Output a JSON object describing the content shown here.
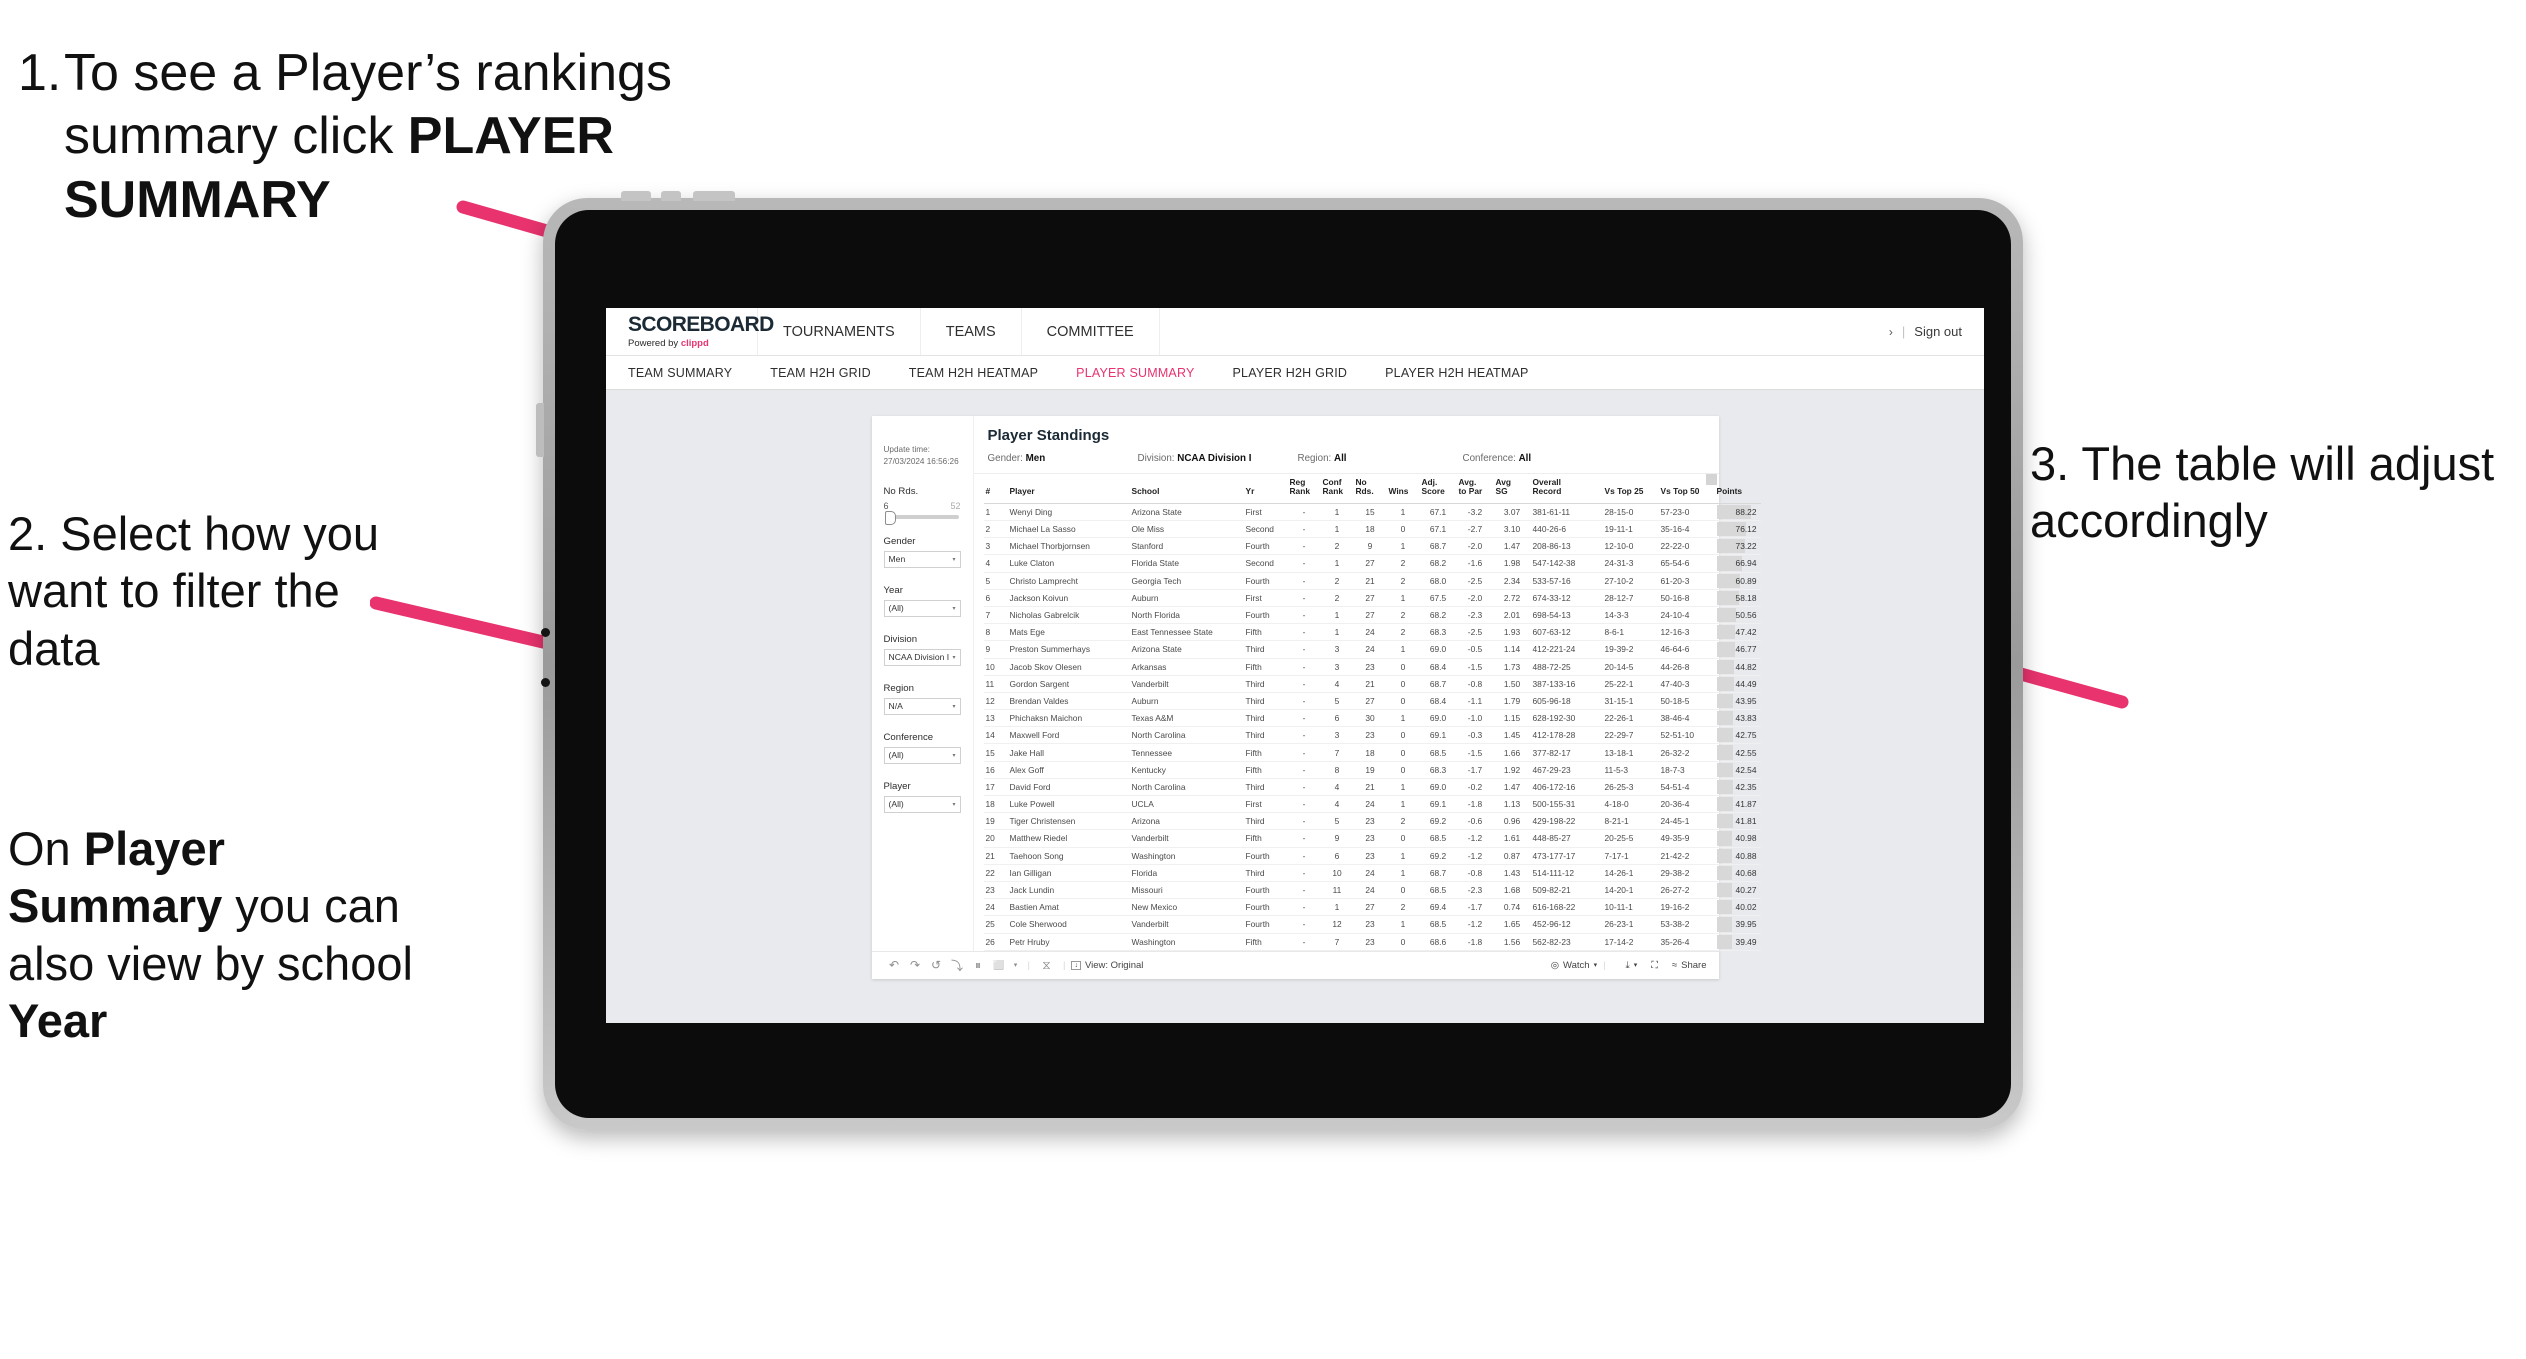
{
  "annotations": {
    "step1_num": "1.",
    "step1_text_a": "To see a Player’s rankings summary click ",
    "step1_text_b": "PLAYER SUMMARY",
    "step2": "2. Select how you want to filter the data",
    "step3": "3. The table will adjust accordingly",
    "step4_a": "On ",
    "step4_b": "Player Summary",
    "step4_c": " you can also view by school ",
    "step4_d": "Year"
  },
  "brand": {
    "title": "SCOREBOARD",
    "powered_prefix": "Powered by ",
    "powered_name": "clippd"
  },
  "topnav": {
    "items": [
      "TOURNAMENTS",
      "TEAMS",
      "COMMITTEE"
    ],
    "chevron": "›",
    "separator": "|",
    "signout": "Sign out"
  },
  "subnav": {
    "items": [
      {
        "label": "TEAM SUMMARY",
        "active": false
      },
      {
        "label": "TEAM H2H GRID",
        "active": false
      },
      {
        "label": "TEAM H2H HEATMAP",
        "active": false
      },
      {
        "label": "PLAYER SUMMARY",
        "active": true
      },
      {
        "label": "PLAYER H2H GRID",
        "active": false
      },
      {
        "label": "PLAYER H2H HEATMAP",
        "active": false
      }
    ],
    "accent_color": "#e8336e"
  },
  "update": {
    "label": "Update time:",
    "value": "27/03/2024 16:56:26"
  },
  "filters": {
    "slider": {
      "label": "No Rds.",
      "min": "6",
      "max": "52"
    },
    "selects": [
      {
        "label": "Gender",
        "value": "Men"
      },
      {
        "label": "Year",
        "value": "(All)"
      },
      {
        "label": "Division",
        "value": "NCAA Division I"
      },
      {
        "label": "Region",
        "value": "N/A"
      },
      {
        "label": "Conference",
        "value": "(All)"
      },
      {
        "label": "Player",
        "value": "(All)"
      }
    ],
    "caret": "▾"
  },
  "panel": {
    "title": "Player Standings",
    "meta": [
      {
        "label": "Gender: ",
        "value": "Men"
      },
      {
        "label": "Division: ",
        "value": "NCAA Division I"
      },
      {
        "label": "Region: ",
        "value": "All"
      },
      {
        "label": "Conference: ",
        "value": "All"
      }
    ]
  },
  "table": {
    "headers": [
      "#",
      "Player",
      "School",
      "Yr",
      "Reg Rank",
      "Conf Rank",
      "No Rds.",
      "Wins",
      "Adj. Score",
      "Avg. to Par",
      "Avg SG",
      "Overall Record",
      "Vs Top 25",
      "Vs Top 50",
      "Points"
    ],
    "headers_split": [
      {
        "l1": "#",
        "l2": ""
      },
      {
        "l1": "Player",
        "l2": ""
      },
      {
        "l1": "School",
        "l2": ""
      },
      {
        "l1": "Yr",
        "l2": ""
      },
      {
        "l1": "Reg",
        "l2": "Rank"
      },
      {
        "l1": "Conf",
        "l2": "Rank"
      },
      {
        "l1": "No",
        "l2": "Rds."
      },
      {
        "l1": "",
        "l2": "Wins"
      },
      {
        "l1": "Adj.",
        "l2": "Score"
      },
      {
        "l1": "Avg.",
        "l2": "to Par"
      },
      {
        "l1": "Avg",
        "l2": "SG"
      },
      {
        "l1": "Overall",
        "l2": "Record"
      },
      {
        "l1": "",
        "l2": "Vs Top 25"
      },
      {
        "l1": "",
        "l2": "Vs Top 50"
      },
      {
        "l1": "",
        "l2": "Points"
      }
    ],
    "rows": [
      [
        "1",
        "Wenyi Ding",
        "Arizona State",
        "First",
        "-",
        "1",
        "15",
        "1",
        "67.1",
        "-3.2",
        "3.07",
        "381-61-11",
        "28-15-0",
        "57-23-0",
        "88.22"
      ],
      [
        "2",
        "Michael La Sasso",
        "Ole Miss",
        "Second",
        "-",
        "1",
        "18",
        "0",
        "67.1",
        "-2.7",
        "3.10",
        "440-26-6",
        "19-11-1",
        "35-16-4",
        "76.12"
      ],
      [
        "3",
        "Michael Thorbjornsen",
        "Stanford",
        "Fourth",
        "-",
        "2",
        "9",
        "1",
        "68.7",
        "-2.0",
        "1.47",
        "208-86-13",
        "12-10-0",
        "22-22-0",
        "73.22"
      ],
      [
        "4",
        "Luke Claton",
        "Florida State",
        "Second",
        "-",
        "1",
        "27",
        "2",
        "68.2",
        "-1.6",
        "1.98",
        "547-142-38",
        "24-31-3",
        "65-54-6",
        "66.94"
      ],
      [
        "5",
        "Christo Lamprecht",
        "Georgia Tech",
        "Fourth",
        "-",
        "2",
        "21",
        "2",
        "68.0",
        "-2.5",
        "2.34",
        "533-57-16",
        "27-10-2",
        "61-20-3",
        "60.89"
      ],
      [
        "6",
        "Jackson Koivun",
        "Auburn",
        "First",
        "-",
        "2",
        "27",
        "1",
        "67.5",
        "-2.0",
        "2.72",
        "674-33-12",
        "28-12-7",
        "50-16-8",
        "58.18"
      ],
      [
        "7",
        "Nicholas Gabrelcik",
        "North Florida",
        "Fourth",
        "-",
        "1",
        "27",
        "2",
        "68.2",
        "-2.3",
        "2.01",
        "698-54-13",
        "14-3-3",
        "24-10-4",
        "50.56"
      ],
      [
        "8",
        "Mats Ege",
        "East Tennessee State",
        "Fifth",
        "-",
        "1",
        "24",
        "2",
        "68.3",
        "-2.5",
        "1.93",
        "607-63-12",
        "8-6-1",
        "12-16-3",
        "47.42"
      ],
      [
        "9",
        "Preston Summerhays",
        "Arizona State",
        "Third",
        "-",
        "3",
        "24",
        "1",
        "69.0",
        "-0.5",
        "1.14",
        "412-221-24",
        "19-39-2",
        "46-64-6",
        "46.77"
      ],
      [
        "10",
        "Jacob Skov Olesen",
        "Arkansas",
        "Fifth",
        "-",
        "3",
        "23",
        "0",
        "68.4",
        "-1.5",
        "1.73",
        "488-72-25",
        "20-14-5",
        "44-26-8",
        "44.82"
      ],
      [
        "11",
        "Gordon Sargent",
        "Vanderbilt",
        "Third",
        "-",
        "4",
        "21",
        "0",
        "68.7",
        "-0.8",
        "1.50",
        "387-133-16",
        "25-22-1",
        "47-40-3",
        "44.49"
      ],
      [
        "12",
        "Brendan Valdes",
        "Auburn",
        "Third",
        "-",
        "5",
        "27",
        "0",
        "68.4",
        "-1.1",
        "1.79",
        "605-96-18",
        "31-15-1",
        "50-18-5",
        "43.95"
      ],
      [
        "13",
        "Phichaksn Maichon",
        "Texas A&M",
        "Third",
        "-",
        "6",
        "30",
        "1",
        "69.0",
        "-1.0",
        "1.15",
        "628-192-30",
        "22-26-1",
        "38-46-4",
        "43.83"
      ],
      [
        "14",
        "Maxwell Ford",
        "North Carolina",
        "Third",
        "-",
        "3",
        "23",
        "0",
        "69.1",
        "-0.3",
        "1.45",
        "412-178-28",
        "22-29-7",
        "52-51-10",
        "42.75"
      ],
      [
        "15",
        "Jake Hall",
        "Tennessee",
        "Fifth",
        "-",
        "7",
        "18",
        "0",
        "68.5",
        "-1.5",
        "1.66",
        "377-82-17",
        "13-18-1",
        "26-32-2",
        "42.55"
      ],
      [
        "16",
        "Alex Goff",
        "Kentucky",
        "Fifth",
        "-",
        "8",
        "19",
        "0",
        "68.3",
        "-1.7",
        "1.92",
        "467-29-23",
        "11-5-3",
        "18-7-3",
        "42.54"
      ],
      [
        "17",
        "David Ford",
        "North Carolina",
        "Third",
        "-",
        "4",
        "21",
        "1",
        "69.0",
        "-0.2",
        "1.47",
        "406-172-16",
        "26-25-3",
        "54-51-4",
        "42.35"
      ],
      [
        "18",
        "Luke Powell",
        "UCLA",
        "First",
        "-",
        "4",
        "24",
        "1",
        "69.1",
        "-1.8",
        "1.13",
        "500-155-31",
        "4-18-0",
        "20-36-4",
        "41.87"
      ],
      [
        "19",
        "Tiger Christensen",
        "Arizona",
        "Third",
        "-",
        "5",
        "23",
        "2",
        "69.2",
        "-0.6",
        "0.96",
        "429-198-22",
        "8-21-1",
        "24-45-1",
        "41.81"
      ],
      [
        "20",
        "Matthew Riedel",
        "Vanderbilt",
        "Fifth",
        "-",
        "9",
        "23",
        "0",
        "68.5",
        "-1.2",
        "1.61",
        "448-85-27",
        "20-25-5",
        "49-35-9",
        "40.98"
      ],
      [
        "21",
        "Taehoon Song",
        "Washington",
        "Fourth",
        "-",
        "6",
        "23",
        "1",
        "69.2",
        "-1.2",
        "0.87",
        "473-177-17",
        "7-17-1",
        "21-42-2",
        "40.88"
      ],
      [
        "22",
        "Ian Gilligan",
        "Florida",
        "Third",
        "-",
        "10",
        "24",
        "1",
        "68.7",
        "-0.8",
        "1.43",
        "514-111-12",
        "14-26-1",
        "29-38-2",
        "40.68"
      ],
      [
        "23",
        "Jack Lundin",
        "Missouri",
        "Fourth",
        "-",
        "11",
        "24",
        "0",
        "68.5",
        "-2.3",
        "1.68",
        "509-82-21",
        "14-20-1",
        "26-27-2",
        "40.27"
      ],
      [
        "24",
        "Bastien Amat",
        "New Mexico",
        "Fourth",
        "-",
        "1",
        "27",
        "2",
        "69.4",
        "-1.7",
        "0.74",
        "616-168-22",
        "10-11-1",
        "19-16-2",
        "40.02"
      ],
      [
        "25",
        "Cole Sherwood",
        "Vanderbilt",
        "Fourth",
        "-",
        "12",
        "23",
        "1",
        "68.5",
        "-1.2",
        "1.65",
        "452-96-12",
        "26-23-1",
        "53-38-2",
        "39.95"
      ],
      [
        "26",
        "Petr Hruby",
        "Washington",
        "Fifth",
        "-",
        "7",
        "23",
        "0",
        "68.6",
        "-1.8",
        "1.56",
        "562-82-23",
        "17-14-2",
        "35-26-4",
        "39.49"
      ]
    ],
    "points_max": 88.22
  },
  "toolbar": {
    "undo_icon": "↶",
    "redo_icon": "↷",
    "revert_icon": "↺",
    "refresh_icon": "⤵",
    "pause_icon": "⏸",
    "zoom_icon": "⬜",
    "zoom_caret": "▾",
    "history_icon": "⧖",
    "view_icon": "↓",
    "view_label": "View: Original",
    "watch_icon": "◎",
    "watch_label": "Watch",
    "watch_caret": "▾",
    "download_icon": "⤓",
    "download_caret": "▾",
    "fullscreen_icon": "⛶",
    "share_icon": "≈",
    "share_label": "Share"
  }
}
